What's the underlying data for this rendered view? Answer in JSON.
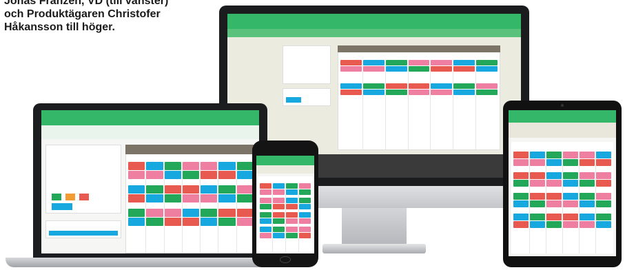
{
  "caption": {
    "line1": "Jonas Franzén, VD (till vänster)",
    "line2": "och Produktägaren Christofer",
    "line3": "Håkansson till höger."
  },
  "colors": {
    "brand_green": "#34b768",
    "event_red": "#e85a4f",
    "event_pink": "#ef7fa0",
    "event_green": "#23a85a",
    "event_blue": "#18a8e0",
    "event_orange": "#f39c34"
  },
  "devices": [
    "imac",
    "laptop",
    "phone",
    "tablet"
  ]
}
